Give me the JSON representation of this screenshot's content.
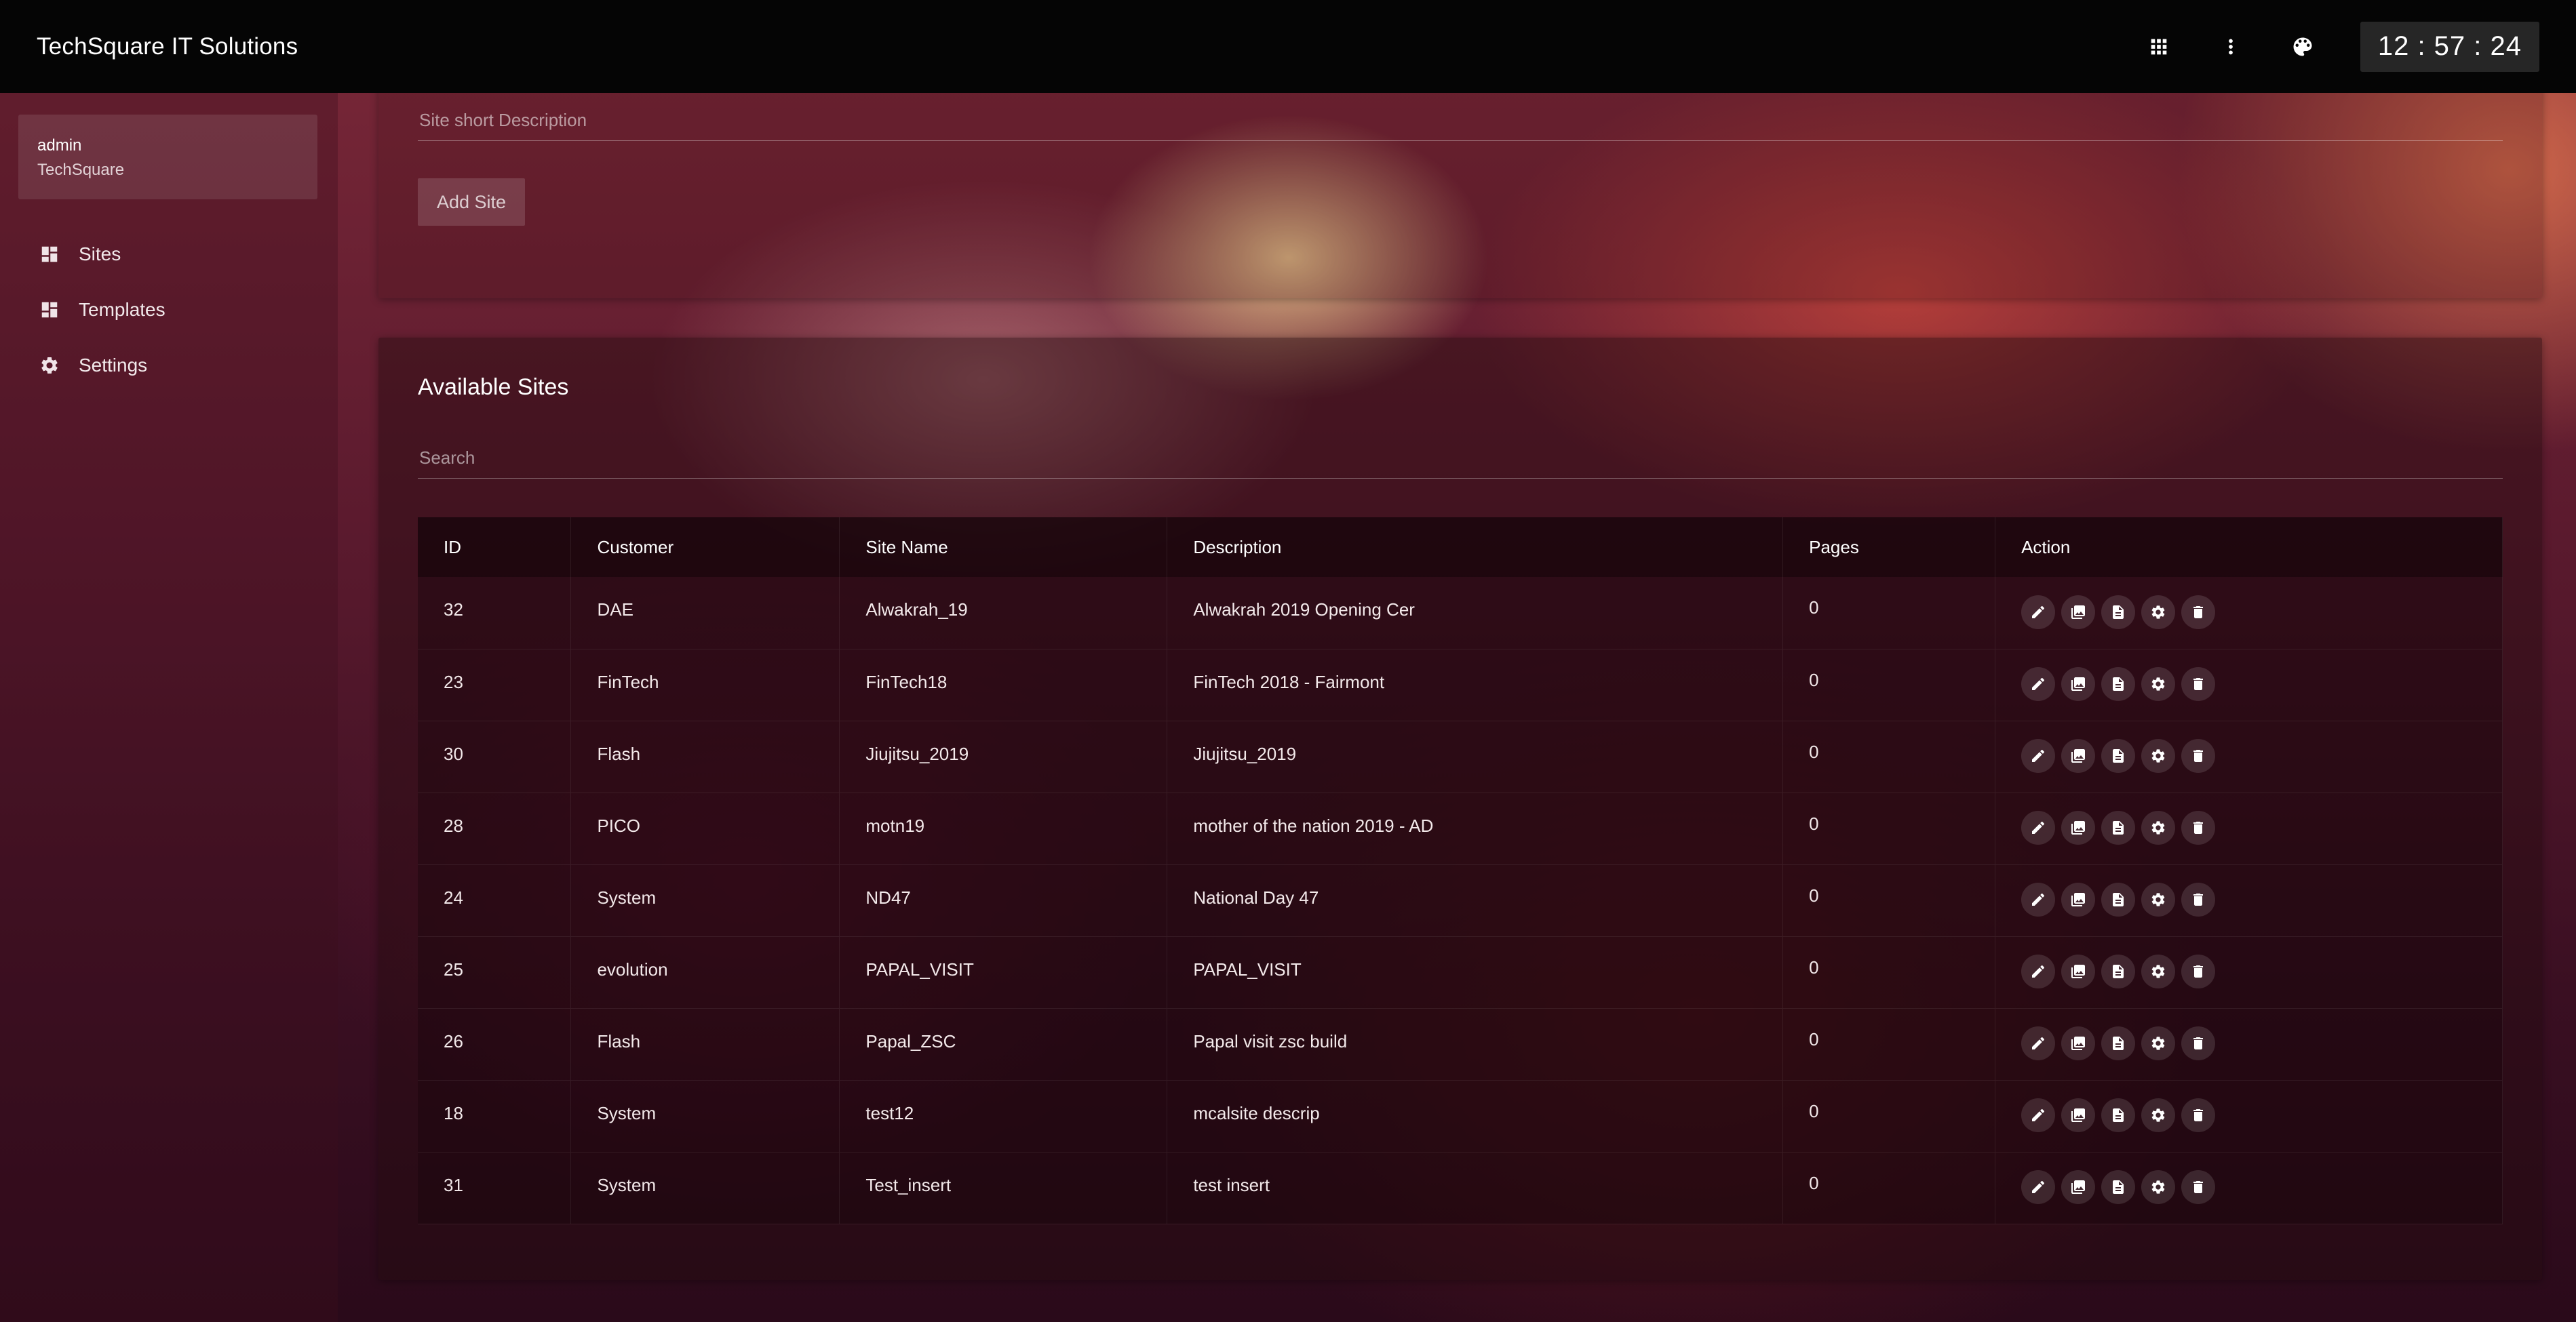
{
  "header": {
    "app_title": "TechSquare IT Solutions",
    "clock": "12 : 57 : 24",
    "icons": [
      "apps-grid-icon",
      "more-vert-icon",
      "palette-icon"
    ]
  },
  "sidebar": {
    "user": {
      "name": "admin",
      "org": "TechSquare"
    },
    "items": [
      {
        "label": "Sites",
        "icon": "dashboard-icon"
      },
      {
        "label": "Templates",
        "icon": "dashboard-icon"
      },
      {
        "label": "Settings",
        "icon": "gear-icon"
      }
    ]
  },
  "add_site": {
    "description_placeholder": "Site short Description",
    "add_button": "Add Site"
  },
  "sites": {
    "title": "Available Sites",
    "search_placeholder": "Search",
    "columns": [
      "ID",
      "Customer",
      "Site Name",
      "Description",
      "Pages",
      "Action"
    ],
    "rows": [
      {
        "id": "32",
        "customer": "DAE",
        "site_name": "Alwakrah_19",
        "description": "Alwakrah 2019 Opening Cer",
        "pages": "0"
      },
      {
        "id": "23",
        "customer": "FinTech",
        "site_name": "FinTech18",
        "description": "FinTech 2018 - Fairmont",
        "pages": "0"
      },
      {
        "id": "30",
        "customer": "Flash",
        "site_name": "Jiujitsu_2019",
        "description": "Jiujitsu_2019",
        "pages": "0"
      },
      {
        "id": "28",
        "customer": "PICO",
        "site_name": "motn19",
        "description": "mother of the nation 2019 - AD",
        "pages": "0"
      },
      {
        "id": "24",
        "customer": "System",
        "site_name": "ND47",
        "description": "National Day 47",
        "pages": "0"
      },
      {
        "id": "25",
        "customer": "evolution",
        "site_name": "PAPAL_VISIT",
        "description": "PAPAL_VISIT",
        "pages": "0"
      },
      {
        "id": "26",
        "customer": "Flash",
        "site_name": "Papal_ZSC",
        "description": "Papal visit zsc build",
        "pages": "0"
      },
      {
        "id": "18",
        "customer": "System",
        "site_name": "test12",
        "description": "mcalsite descrip",
        "pages": "0"
      },
      {
        "id": "31",
        "customer": "System",
        "site_name": "Test_insert",
        "description": "test insert",
        "pages": "0"
      }
    ],
    "row_actions": [
      "edit-icon",
      "image-icon",
      "document-icon",
      "gear-icon",
      "delete-icon"
    ]
  }
}
